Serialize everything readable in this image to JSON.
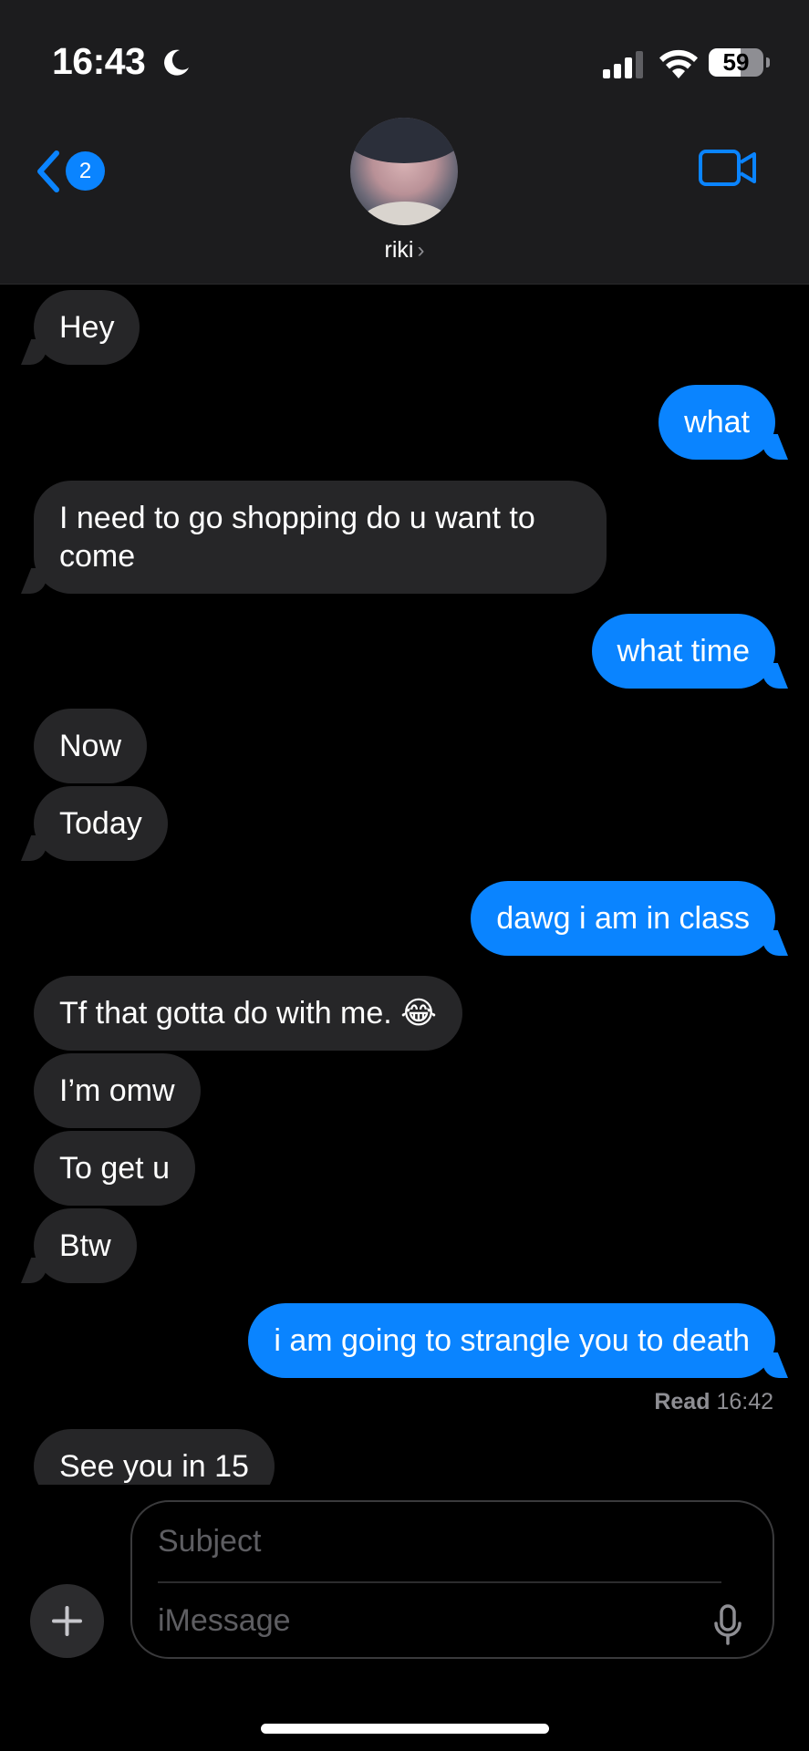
{
  "status_bar": {
    "time": "16:43",
    "battery_percent": "59",
    "battery_level": 0.59,
    "icons": [
      "moon-icon",
      "signal-icon",
      "wifi-icon",
      "battery-icon"
    ]
  },
  "header": {
    "back_badge": "2",
    "contact_name": "riki",
    "chevron": "›",
    "icons": [
      "chevron-left-icon",
      "video-camera-icon"
    ]
  },
  "colors": {
    "accent": "#0a84ff",
    "incoming_bubble": "#262628",
    "background": "#000000"
  },
  "messages": [
    {
      "text": "Hey",
      "direction": "incoming"
    },
    {
      "text": "what",
      "direction": "outgoing"
    },
    {
      "text": "I need to go shopping do u want to come",
      "direction": "incoming"
    },
    {
      "text": "what time",
      "direction": "outgoing"
    },
    {
      "text": "Now",
      "direction": "incoming"
    },
    {
      "text": "Today",
      "direction": "incoming"
    },
    {
      "text": "dawg i am in class",
      "direction": "outgoing"
    },
    {
      "text": "Tf that gotta do with me. 😂",
      "direction": "incoming"
    },
    {
      "text": "I’m omw",
      "direction": "incoming"
    },
    {
      "text": "To get u",
      "direction": "incoming"
    },
    {
      "text": "Btw",
      "direction": "incoming"
    },
    {
      "text": "i am going to strangle you to death",
      "direction": "outgoing"
    },
    {
      "text": "See you in 15",
      "direction": "incoming"
    }
  ],
  "read_receipt": {
    "label": "Read",
    "time": "16:42"
  },
  "composer": {
    "subject_placeholder": "Subject",
    "message_placeholder": "iMessage",
    "icons": [
      "plus-icon",
      "microphone-icon"
    ]
  }
}
